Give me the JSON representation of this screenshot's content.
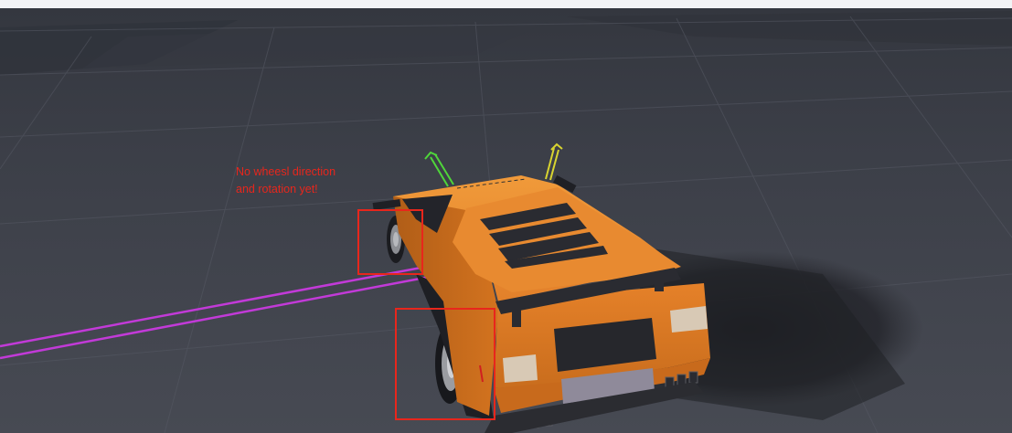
{
  "annotation": {
    "line1": "No wheesl direction",
    "line2": "and rotation yet!"
  },
  "colors": {
    "annotation": "#e8261c",
    "car_body": "#e07a22",
    "floor": "#3f424b",
    "sky": "#f2f3f5",
    "debug_trace": "#c23ad8",
    "gizmo_green": "#4fd63a",
    "gizmo_yellow": "#d8d430"
  },
  "scene": {
    "object": "orange-sports-car",
    "floor": "grid-floor",
    "markers": [
      "rear-wheel-box",
      "front-wheel-box"
    ]
  }
}
